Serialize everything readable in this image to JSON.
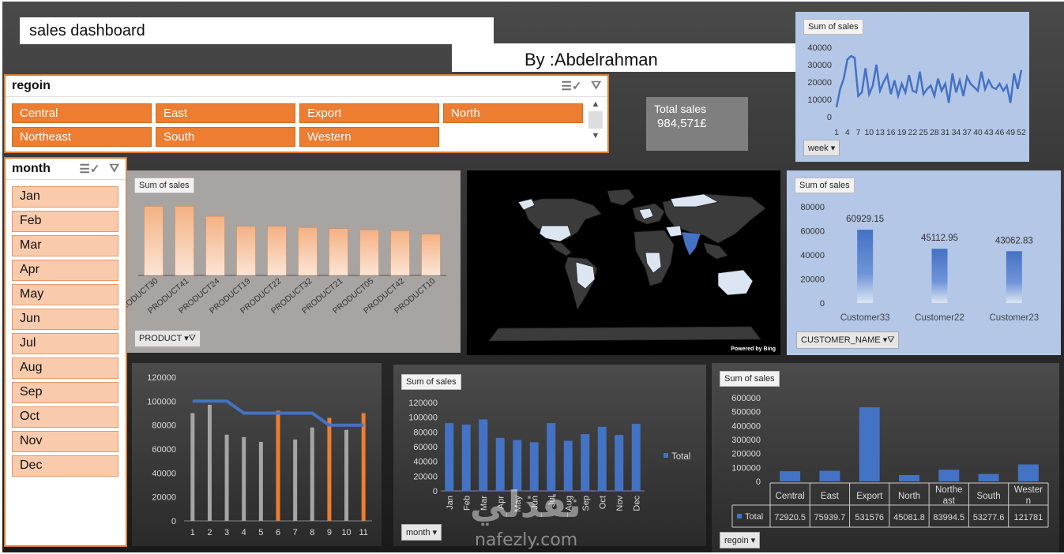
{
  "header": {
    "title": "sales dashboard",
    "author": "By :Abdelrahman"
  },
  "region_slicer": {
    "title": "regoin",
    "items": [
      "Central",
      "East",
      "Export",
      "North",
      "Northeast",
      "South",
      "Western"
    ]
  },
  "month_slicer": {
    "title": "month",
    "items": [
      "Jan",
      "Feb",
      "Mar",
      "Apr",
      "May",
      "Jun",
      "Jul",
      "Aug",
      "Sep",
      "Oct",
      "Nov",
      "Dec"
    ]
  },
  "kpi": {
    "label": "Total sales",
    "value": "984,571",
    "currency": "£"
  },
  "map": {
    "credit": "Powered by Bing",
    "highlight_color": "#4472c4",
    "land_color": "#3b3b3b",
    "light_land_color": "#dce6f2"
  },
  "colors": {
    "accent_orange": "#ed7d31",
    "accent_blue": "#4472c4",
    "slicer_chip": "#f9cbac"
  },
  "chart_data": [
    {
      "id": "weekly",
      "type": "line",
      "series_tag": "Sum of sales",
      "filter_label": "week",
      "x": [
        1,
        2,
        3,
        4,
        5,
        6,
        7,
        8,
        9,
        10,
        11,
        12,
        13,
        14,
        15,
        16,
        17,
        18,
        19,
        20,
        21,
        22,
        23,
        24,
        25,
        26,
        27,
        28,
        29,
        30,
        31,
        32,
        33,
        34,
        35,
        36,
        37,
        38,
        39,
        40,
        41,
        42,
        43,
        44,
        45,
        46,
        47,
        48,
        49,
        50,
        51,
        52
      ],
      "x_tick_labels": [
        "1",
        "4",
        "7",
        "10",
        "13",
        "16",
        "19",
        "22",
        "25",
        "28",
        "31",
        "34",
        "37",
        "40",
        "43",
        "46",
        "49",
        "52"
      ],
      "values": [
        5500,
        16000,
        22000,
        33000,
        35000,
        34000,
        12000,
        14000,
        28000,
        13000,
        18000,
        30000,
        15000,
        20000,
        24000,
        13000,
        21000,
        12000,
        19000,
        14000,
        24000,
        15000,
        14000,
        26000,
        13000,
        16000,
        18000,
        12000,
        22000,
        15000,
        19000,
        8000,
        25000,
        14000,
        21000,
        12000,
        23000,
        19000,
        17000,
        15000,
        26000,
        16000,
        21000,
        17000,
        16000,
        19000,
        15000,
        18000,
        8000,
        25000,
        16000,
        27000
      ],
      "yticks": [
        0,
        10000,
        20000,
        30000,
        40000
      ],
      "ylim": [
        0,
        40000
      ]
    },
    {
      "id": "product",
      "type": "bar",
      "series_tag": "Sum of sales",
      "filter_label": "PRODUCT",
      "categories": [
        "PRODUCT30",
        "PRODUCT41",
        "PRODUCT24",
        "PRODUCT19",
        "PRODUCT22",
        "PRODUCT32",
        "PRODUCT21",
        "PRODUCT05",
        "PRODUCT42",
        "PRODUCT10"
      ],
      "values": [
        62000,
        62000,
        53000,
        44000,
        44000,
        43000,
        42000,
        41000,
        40000,
        37000
      ],
      "ylim": [
        0,
        80000
      ]
    },
    {
      "id": "customer",
      "type": "bar",
      "series_tag": "Sum of sales",
      "filter_label": "CUSTOMER_NAME",
      "categories": [
        "Customer33",
        "Customer22",
        "Customer23"
      ],
      "values": [
        60929.15,
        45112.95,
        43062.83
      ],
      "data_labels": [
        "60929.15",
        "45112.95",
        "43062.83"
      ],
      "yticks": [
        0,
        20000,
        40000,
        60000,
        80000
      ],
      "ylim": [
        0,
        80000
      ]
    },
    {
      "id": "monthly_combo",
      "type": "bar",
      "categories": [
        "1",
        "2",
        "3",
        "4",
        "5",
        "6",
        "7",
        "8",
        "9",
        "10",
        "11"
      ],
      "values": [
        90000,
        97000,
        72000,
        70000,
        66000,
        92000,
        68000,
        78000,
        86000,
        76000,
        90000
      ],
      "highlight_indices": [
        5,
        8,
        10
      ],
      "line_values": [
        100000,
        100000,
        100000,
        90000,
        90000,
        90000,
        90000,
        90000,
        80000,
        80000,
        80000
      ],
      "yticks": [
        0,
        20000,
        40000,
        60000,
        80000,
        100000,
        120000
      ],
      "ylim": [
        0,
        120000
      ]
    },
    {
      "id": "month_sales",
      "type": "bar",
      "series_tag": "Sum of sales",
      "filter_label": "month",
      "legend": "Total",
      "categories": [
        "Jan",
        "Feb",
        "Mar",
        "Apr",
        "May",
        "Jun",
        "Jul",
        "Aug",
        "Sep",
        "Oct",
        "Nov",
        "Dec"
      ],
      "values": [
        92000,
        90000,
        97000,
        72000,
        69000,
        66000,
        92000,
        68000,
        77000,
        87000,
        76000,
        91000
      ],
      "yticks": [
        0,
        20000,
        40000,
        60000,
        80000,
        100000,
        120000
      ],
      "ylim": [
        0,
        120000
      ]
    },
    {
      "id": "region_sales",
      "type": "bar",
      "series_tag": "Sum of sales",
      "filter_label": "regoin",
      "legend": "Total",
      "categories": [
        "Central",
        "East",
        "Export",
        "North",
        "Northe ast",
        "South",
        "Wester n"
      ],
      "values": [
        72920.5,
        75939.7,
        531576,
        45081.8,
        83994.5,
        53277.6,
        121781
      ],
      "table_values": [
        "72920.5",
        "75939.7",
        "531576",
        "45081.8",
        "83994.5",
        "53277.6",
        "121781"
      ],
      "yticks": [
        0,
        100000,
        200000,
        300000,
        400000,
        500000,
        600000
      ],
      "ylim": [
        0,
        600000
      ]
    }
  ],
  "watermark": {
    "arabic": "نفذلي",
    "latin": "nafezly.com"
  }
}
